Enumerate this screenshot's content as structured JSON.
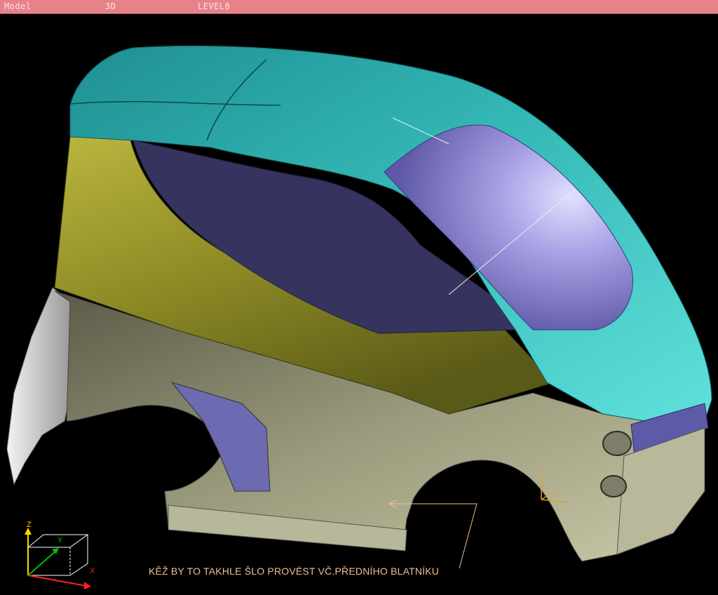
{
  "titlebar": {
    "mode": "Model",
    "view": "3D",
    "level": "LEVEL0"
  },
  "viewport": {
    "caption": "KĚŽ BY TO TAKHLE ŠLO PROVÉST VČ.PŘEDNÍHO BLATNÍKU",
    "axes": {
      "z": "Z",
      "y": "Y",
      "x": "X"
    },
    "colors": {
      "background": "#000000",
      "roof": "#2fb3b3",
      "side_panel_olive": "#9b9a2a",
      "lower_body_grey": "#8a8a6a",
      "window_dark": "#3a3766",
      "windshield": "#8f87d0",
      "front_bumper_blue": "#5d5aa8",
      "annotation": "#f0c090"
    }
  }
}
